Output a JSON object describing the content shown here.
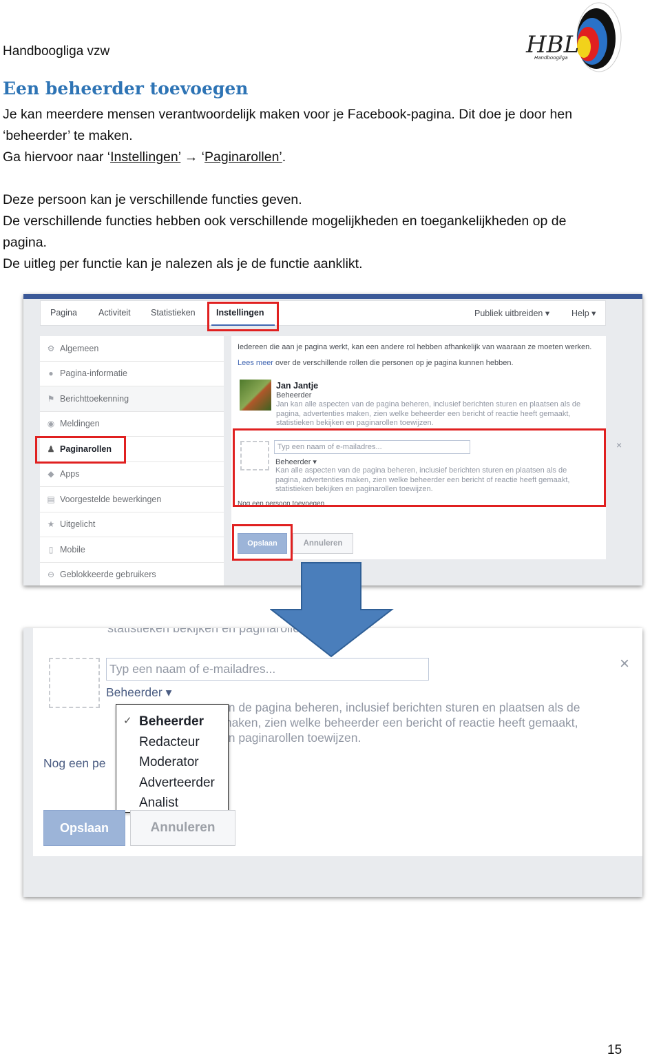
{
  "header": {
    "organization": "Handboogliga vzw",
    "logo_text": "HBL",
    "logo_subtext": "Handboogliga"
  },
  "title": "Een beheerder toevoegen",
  "paragraphs": {
    "p1_line1": "Je kan meerdere mensen verantwoordelijk maken voor je Facebook-pagina. Dit doe je door hen",
    "p1_line2": "‘beheerder’ te maken.",
    "p2_prefix": "Ga hiervoor naar ‘",
    "p2_link1": "Instellingen’",
    "p2_arrow": " → ‘",
    "p2_link2": "Paginarollen’",
    "p2_suffix": ".",
    "p3": "Deze persoon kan je verschillende functies geven.",
    "p4_line1": "De verschillende functies hebben ook verschillende mogelijkheden en toegankelijkheden op de",
    "p4_line2": "pagina.",
    "p5": "De uitleg per functie kan je nalezen als je de functie aanklikt."
  },
  "screenshot1": {
    "tabs": [
      "Pagina",
      "Activiteit",
      "Statistieken",
      "Instellingen"
    ],
    "right_tabs": [
      "Publiek uitbreiden ▾",
      "Help ▾"
    ],
    "sidebar": [
      {
        "label": "Algemeen",
        "icon": "gear-icon",
        "glyph": "⚙"
      },
      {
        "label": "Pagina-informatie",
        "icon": "info-icon",
        "glyph": "●"
      },
      {
        "label": "Berichttoekenning",
        "icon": "flag-icon",
        "glyph": "⚑"
      },
      {
        "label": "Meldingen",
        "icon": "globe-icon",
        "glyph": "◉"
      },
      {
        "label": "Paginarollen",
        "icon": "person-icon",
        "glyph": "♟"
      },
      {
        "label": "Apps",
        "icon": "cube-icon",
        "glyph": "◆"
      },
      {
        "label": "Voorgestelde bewerkingen",
        "icon": "calendar-icon",
        "glyph": "▤"
      },
      {
        "label": "Uitgelicht",
        "icon": "star-icon",
        "glyph": "★"
      },
      {
        "label": "Mobile",
        "icon": "mobile-icon",
        "glyph": "▯"
      },
      {
        "label": "Geblokkeerde gebruikers",
        "icon": "blocked-icon",
        "glyph": "⊖"
      }
    ],
    "intro": "Iedereen die aan je pagina werkt, kan een andere rol hebben afhankelijk van waaraan ze moeten werken.",
    "lees_meer": "Lees meer",
    "lees_meer_rest": " over de verschillende rollen die personen op je pagina kunnen hebben.",
    "person": {
      "name": "Jan Jantje",
      "role": "Beheerder",
      "desc_lines": [
        "Jan kan alle aspecten van de pagina beheren, inclusief berichten sturen en plaatsen als de",
        "pagina, advertenties maken, zien welke beheerder een bericht of reactie heeft gemaakt,",
        "statistieken bekijken en paginarollen toewijzen."
      ]
    },
    "input_placeholder": "Typ een naam of e-mailadres...",
    "role_select": "Beheerder ▾",
    "role_desc_lines": [
      "Kan alle aspecten van de pagina beheren, inclusief berichten sturen en plaatsen als de",
      "pagina, advertenties maken, zien welke beheerder een bericht of reactie heeft gemaakt,",
      "statistieken bekijken en paginarollen toewijzen."
    ],
    "add_another": "Nog een persoon toevoegen",
    "close": "×",
    "save": "Opslaan",
    "cancel": "Annuleren"
  },
  "screenshot2": {
    "top_cut": "statistieken bekijken en paginarollen toewijzen.",
    "input_placeholder": "Typ een naam of e-mailadres...",
    "role_select": "Beheerder ▾",
    "desc_lines": [
      "an de pagina beheren, inclusief berichten sturen en plaatsen als de",
      "maken, zien welke beheerder een bericht of reactie heeft gemaakt,",
      "en paginarollen toewijzen."
    ],
    "add_another": "Nog een pe",
    "close": "×",
    "menu": [
      {
        "label": "Beheerder",
        "checked": true
      },
      {
        "label": "Redacteur"
      },
      {
        "label": "Moderator"
      },
      {
        "label": "Adverteerder"
      },
      {
        "label": "Analist"
      }
    ],
    "check": "✓",
    "save": "Opslaan",
    "cancel": "Annuleren"
  },
  "colors": {
    "heading": "#2e74b5",
    "facebook_blue": "#3b5998",
    "highlight_red": "#e02020",
    "arrow": "#4a7ebb"
  },
  "page_number": "15"
}
